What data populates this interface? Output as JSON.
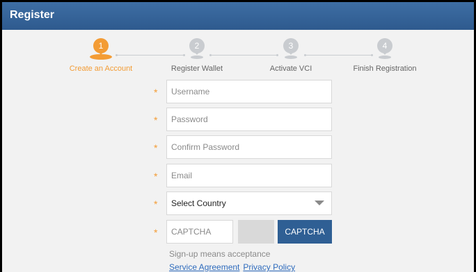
{
  "header": {
    "title": "Register"
  },
  "steps": [
    {
      "number": "1",
      "label": "Create an Account",
      "active": true
    },
    {
      "number": "2",
      "label": "Register Wallet",
      "active": false
    },
    {
      "number": "3",
      "label": "Activate VCI",
      "active": false
    },
    {
      "number": "4",
      "label": "Finish Registration",
      "active": false
    }
  ],
  "form": {
    "required_mark": "*",
    "username_placeholder": "Username",
    "password_placeholder": "Password",
    "confirm_password_placeholder": "Confirm Password",
    "email_placeholder": "Email",
    "country_select_value": "Select Country",
    "captcha_placeholder": "CAPTCHA",
    "captcha_button": "CAPTCHA"
  },
  "footer": {
    "note": "Sign-up means acceptance",
    "service_agreement": "Service Agreement",
    "privacy_policy": "Privacy Policy"
  },
  "colors": {
    "header": "#2e5a8e",
    "accent": "#f39c35",
    "button": "#2f5f94",
    "link": "#2e6bbd"
  }
}
